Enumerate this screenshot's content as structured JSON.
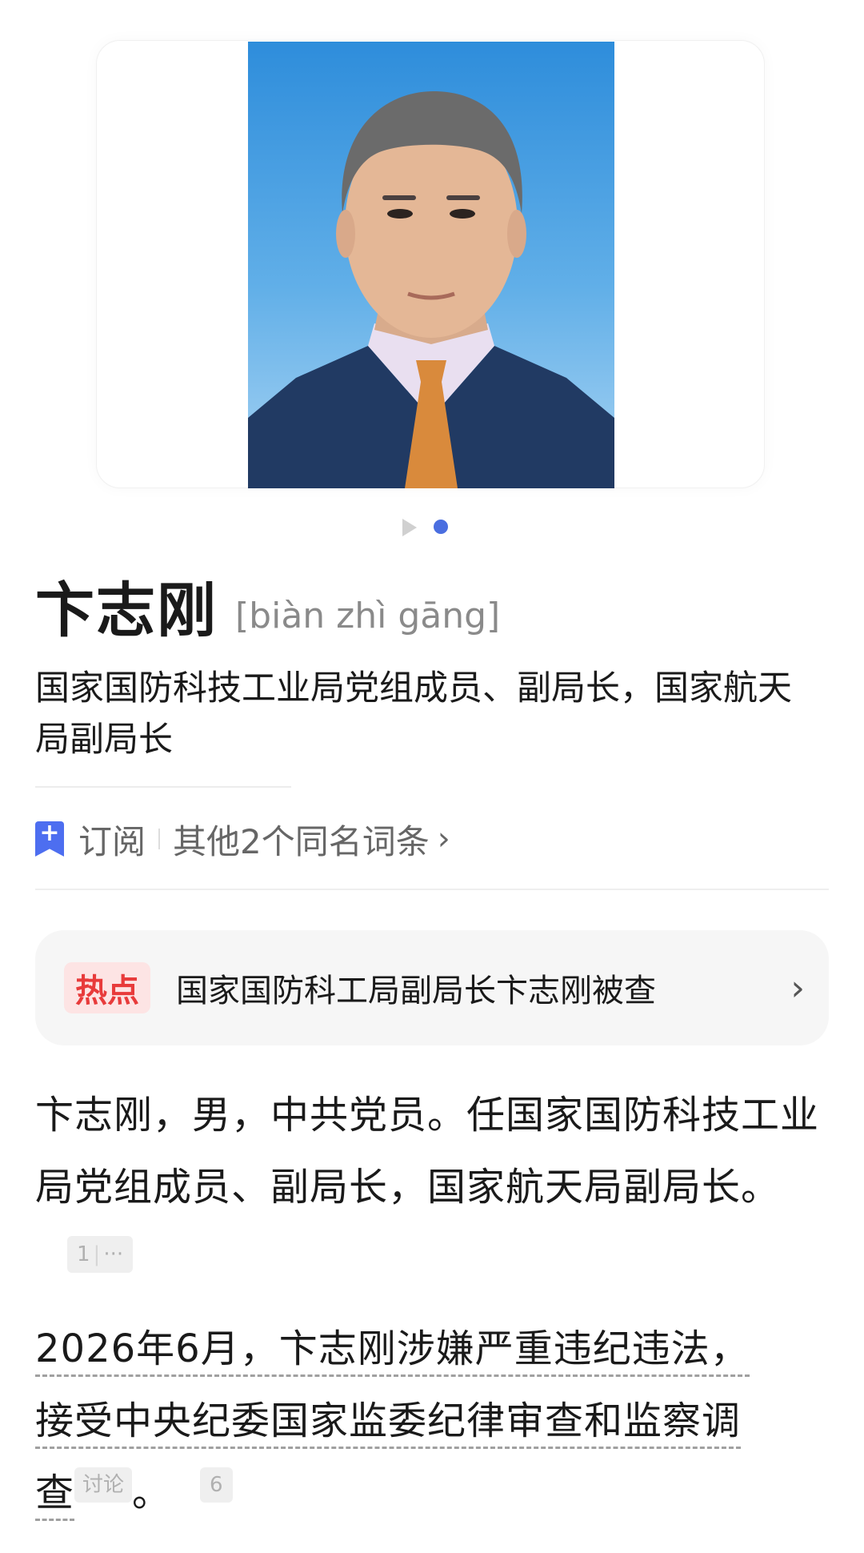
{
  "photo": {
    "alt": "portrait"
  },
  "title": {
    "name": "卞志刚",
    "pinyin": "[biàn zhì gāng]"
  },
  "subtitle": "国家国防科技工业局党组成员、副局长，国家航天局副局长",
  "actions": {
    "subscribe": "订阅",
    "same_name": "其他2个同名词条",
    "chevron": "›"
  },
  "hot": {
    "tag": "热点",
    "text": "国家国防科工局副局长卞志刚被查",
    "chevron": "›"
  },
  "para1": {
    "text": "卞志刚，男，中共党员。任国家国防科技工业局党组成员、副局长，国家航天局副局长。",
    "ref_num": "1",
    "ref_more": "···"
  },
  "para2": {
    "line1": "2026年6月，卞志刚涉嫌严重违纪违法，",
    "line2": "接受中央纪委国家监委纪律审查和监察调",
    "line3": "查",
    "discuss": "讨论",
    "end": "。",
    "ref_num": "6"
  },
  "colors": {
    "accent": "#4a6ee0",
    "hot": "#e83b3b"
  }
}
